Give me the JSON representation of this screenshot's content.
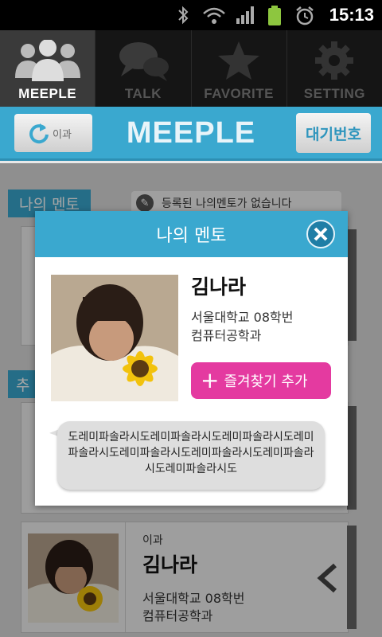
{
  "status_bar": {
    "time": "15:13"
  },
  "tabs": [
    {
      "label": "MEEPLE",
      "icon": "people-icon",
      "active": true
    },
    {
      "label": "TALK",
      "icon": "chat-icon",
      "active": false
    },
    {
      "label": "FAVORITE",
      "icon": "star-icon",
      "active": false
    },
    {
      "label": "SETTING",
      "icon": "gear-icon",
      "active": false
    }
  ],
  "header": {
    "title": "MEEPLE",
    "refresh_label": "이과",
    "wait_button": "대기번호"
  },
  "background": {
    "my_mentor_tag": "나의 멘토",
    "recommend_tag": "추",
    "notice": "등록된 나의멘토가 없습니다",
    "card": {
      "track": "이과",
      "name": "김나라",
      "school": "서울대학교  08학번",
      "major": "컴퓨터공학과"
    }
  },
  "dialog": {
    "title": "나의 멘토",
    "name": "김나라",
    "school": "서울대학교  08학번",
    "major": "컴퓨터공학과",
    "favorite_button": "즐겨찾기 추가",
    "message": "도레미파솔라시도레미파솔라시도레미파솔라시도레미파솔라시도레미파솔라시도레미파솔라시도레미파솔라시도레미파솔라시도"
  },
  "colors": {
    "accent": "#3aa8cf",
    "favorite": "#e43aa0"
  }
}
